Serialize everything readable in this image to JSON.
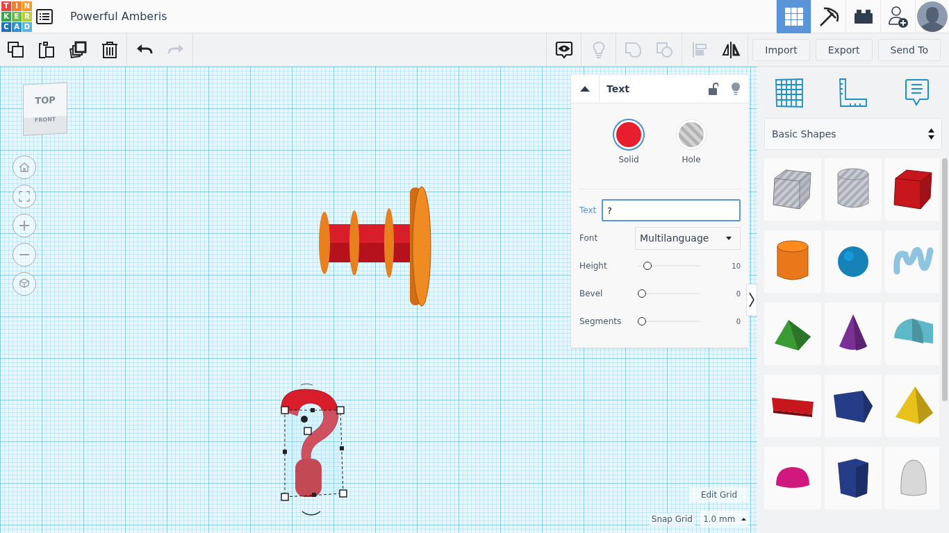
{
  "header": {
    "logo": [
      {
        "char": "T",
        "color": "#e8453c"
      },
      {
        "char": "I",
        "color": "#f07f2e"
      },
      {
        "char": "N",
        "color": "#f59b2a"
      },
      {
        "char": "K",
        "color": "#3aa64c"
      },
      {
        "char": "E",
        "color": "#6cbd45"
      },
      {
        "char": "R",
        "color": "#b7cf3a"
      },
      {
        "char": "C",
        "color": "#1f6fba"
      },
      {
        "char": "A",
        "color": "#2f90d0"
      },
      {
        "char": "D",
        "color": "#5fb3e4"
      }
    ],
    "title": "Powerful Amberis",
    "views": [
      {
        "kind": "grid",
        "selected": true
      },
      {
        "kind": "pickaxe",
        "selected": false
      },
      {
        "kind": "brick",
        "selected": false
      }
    ]
  },
  "toolbar": {
    "edit_tools": [
      {
        "kind": "copy",
        "disabled": false
      },
      {
        "kind": "paste",
        "disabled": false
      },
      {
        "kind": "duplicate",
        "disabled": false
      },
      {
        "kind": "delete",
        "disabled": false
      },
      {
        "kind": "undo",
        "disabled": false
      },
      {
        "kind": "redo",
        "disabled": true
      }
    ],
    "view_tools": [
      {
        "kind": "notes",
        "disabled": false
      },
      {
        "kind": "bulb",
        "disabled": true
      },
      {
        "kind": "group",
        "disabled": true
      },
      {
        "kind": "ungroup",
        "disabled": true
      },
      {
        "kind": "align",
        "disabled": true
      },
      {
        "kind": "mirror",
        "disabled": false
      }
    ],
    "buttons": [
      "Import",
      "Export",
      "Send To"
    ]
  },
  "view_cube": {
    "top": "TOP",
    "front": "FRONT"
  },
  "inspector": {
    "title": "Text",
    "locked": false,
    "materials": [
      {
        "label": "Solid",
        "kind": "solid",
        "selected": true
      },
      {
        "label": "Hole",
        "kind": "hole",
        "selected": false
      }
    ],
    "text_field": {
      "label": "Text",
      "value": "?"
    },
    "font": {
      "label": "Font",
      "value": "Multilanguage"
    },
    "sliders": [
      {
        "label": "Height",
        "level": 0.1,
        "reading": "10"
      },
      {
        "label": "Bevel",
        "level": 0,
        "reading": "0"
      },
      {
        "label": "Segments",
        "level": 0,
        "reading": "0"
      }
    ]
  },
  "grid_controls": {
    "edit_button": "Edit Grid",
    "snap_label": "Snap Grid",
    "snap_value": "1.0 mm"
  },
  "library": {
    "category": "Basic Shapes",
    "shapes": [
      {
        "kind": "box",
        "hole": true,
        "color": "#c8ccd4"
      },
      {
        "kind": "cylinder",
        "hole": true,
        "color": "#c8ccd4"
      },
      {
        "kind": "box",
        "hole": false,
        "color": "#c8161d"
      },
      {
        "kind": "cylinder",
        "hole": false,
        "color": "#e8781a"
      },
      {
        "kind": "sphere",
        "color": "#1583b8"
      },
      {
        "kind": "scribble",
        "color": "#8ec4e0"
      },
      {
        "kind": "roof",
        "color": "#3a9b35"
      },
      {
        "kind": "cone",
        "color": "#7b2f96"
      },
      {
        "kind": "round-roof",
        "color": "#5fb8c8"
      },
      {
        "kind": "text",
        "color": "#c8161d"
      },
      {
        "kind": "wedge",
        "color": "#253d86"
      },
      {
        "kind": "pyramid",
        "color": "#e8c11a"
      },
      {
        "kind": "half-sphere",
        "color": "#d0187e"
      },
      {
        "kind": "polygon",
        "color": "#253d86"
      },
      {
        "kind": "paraboloid",
        "color": "#d8d8d8"
      }
    ]
  }
}
